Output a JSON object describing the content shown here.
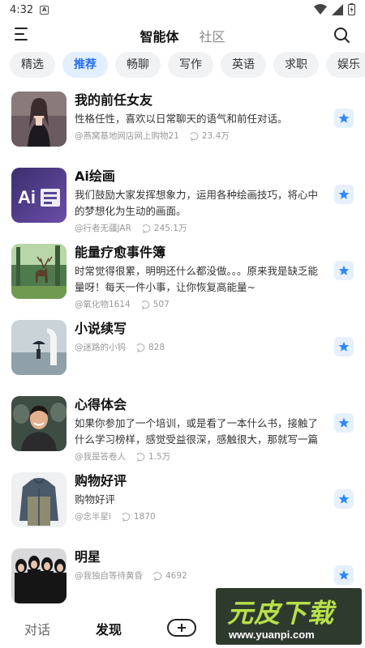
{
  "status_bar": {
    "time": "4:32",
    "notification_letter": "A"
  },
  "header": {
    "tabs": [
      {
        "label": "智能体",
        "active": true
      },
      {
        "label": "社区",
        "active": false
      }
    ]
  },
  "categories": [
    {
      "label": "精选",
      "active": false
    },
    {
      "label": "推荐",
      "active": true
    },
    {
      "label": "畅聊",
      "active": false
    },
    {
      "label": "写作",
      "active": false
    },
    {
      "label": "英语",
      "active": false
    },
    {
      "label": "求职",
      "active": false
    },
    {
      "label": "娱乐",
      "active": false
    }
  ],
  "items": [
    {
      "name": "我的前任女友",
      "desc": "性格任性，喜欢以日常聊天的语气和前任对话。",
      "author": "@燕窝基地网店网上购物21",
      "count": "23.4万",
      "thumb": "portrait-girl"
    },
    {
      "name": "Ai绘画",
      "desc": "我们鼓励大家发挥想象力，运用各种绘画技巧，将心中的梦想化为生动的画面。",
      "author": "@行者无疆JAR",
      "count": "245.1万",
      "thumb": "ai-text"
    },
    {
      "name": "能量疗愈事件簿",
      "desc": "时常觉得很累，明明还什么都没做。。。原来我是缺乏能量呀！每天一件小事，让你恢复高能量~",
      "author": "@氧化物1614",
      "count": "507",
      "thumb": "deer-forest"
    },
    {
      "name": "小说续写",
      "desc": "",
      "author": "@迷路的小钨",
      "count": "828",
      "thumb": "umbrella"
    },
    {
      "name": "心得体会",
      "desc": "如果你参加了一个培训，或是看了一本什么书，接触了什么学习榜样，感觉受益很深，感触很大，那就写一篇学习...",
      "author": "@我是答卷人",
      "count": "1.5万",
      "thumb": "smiling-man"
    },
    {
      "name": "购物好评",
      "desc": "购物好评",
      "author": "@念半星i",
      "count": "1870",
      "thumb": "jacket"
    },
    {
      "name": "明星",
      "desc": "",
      "author": "@我独自等待黄昏",
      "count": "4692",
      "thumb": "group"
    }
  ],
  "bottom_nav": {
    "chat_label": "对话",
    "discover_label": "发现",
    "add_icon": "plus-icon"
  },
  "watermark": {
    "title": "元皮下载",
    "url": "www.yuanpi.com"
  },
  "colors": {
    "accent": "#1f6fe8",
    "chip_active_bg": "#e3efff",
    "star": "#2f8af5"
  }
}
